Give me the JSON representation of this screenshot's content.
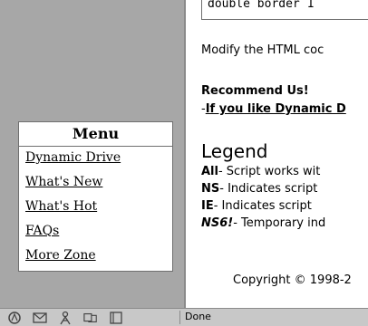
{
  "menu": {
    "title": "Menu",
    "items": [
      {
        "label": "Dynamic Drive"
      },
      {
        "label": "What's New"
      },
      {
        "label": "What's Hot"
      },
      {
        "label": "FAQs"
      },
      {
        "label": "More Zone"
      }
    ]
  },
  "content": {
    "code_snippet": "double border  1",
    "modify_text": "Modify the HTML coc",
    "recommend_heading": "Recommend Us!",
    "recommend_prefix": "-",
    "recommend_link": "If you like Dynamic D",
    "legend_title": "Legend",
    "legend_items": [
      {
        "key": "All",
        "desc": "- Script works wit"
      },
      {
        "key": "NS",
        "desc": "- Indicates script"
      },
      {
        "key": "IE",
        "desc": "- Indicates script"
      },
      {
        "key": "NS6!",
        "desc": "- Temporary ind"
      }
    ],
    "copyright": "Copyright © 1998-2"
  },
  "status_bar": {
    "text": "Done",
    "icons": [
      "navigator-icon",
      "mail-icon",
      "composer-icon",
      "address-book-icon",
      "page-icon"
    ]
  },
  "colors": {
    "left_pane_bg": "#a7a7a7",
    "status_bar_bg": "#c8c8c8"
  }
}
